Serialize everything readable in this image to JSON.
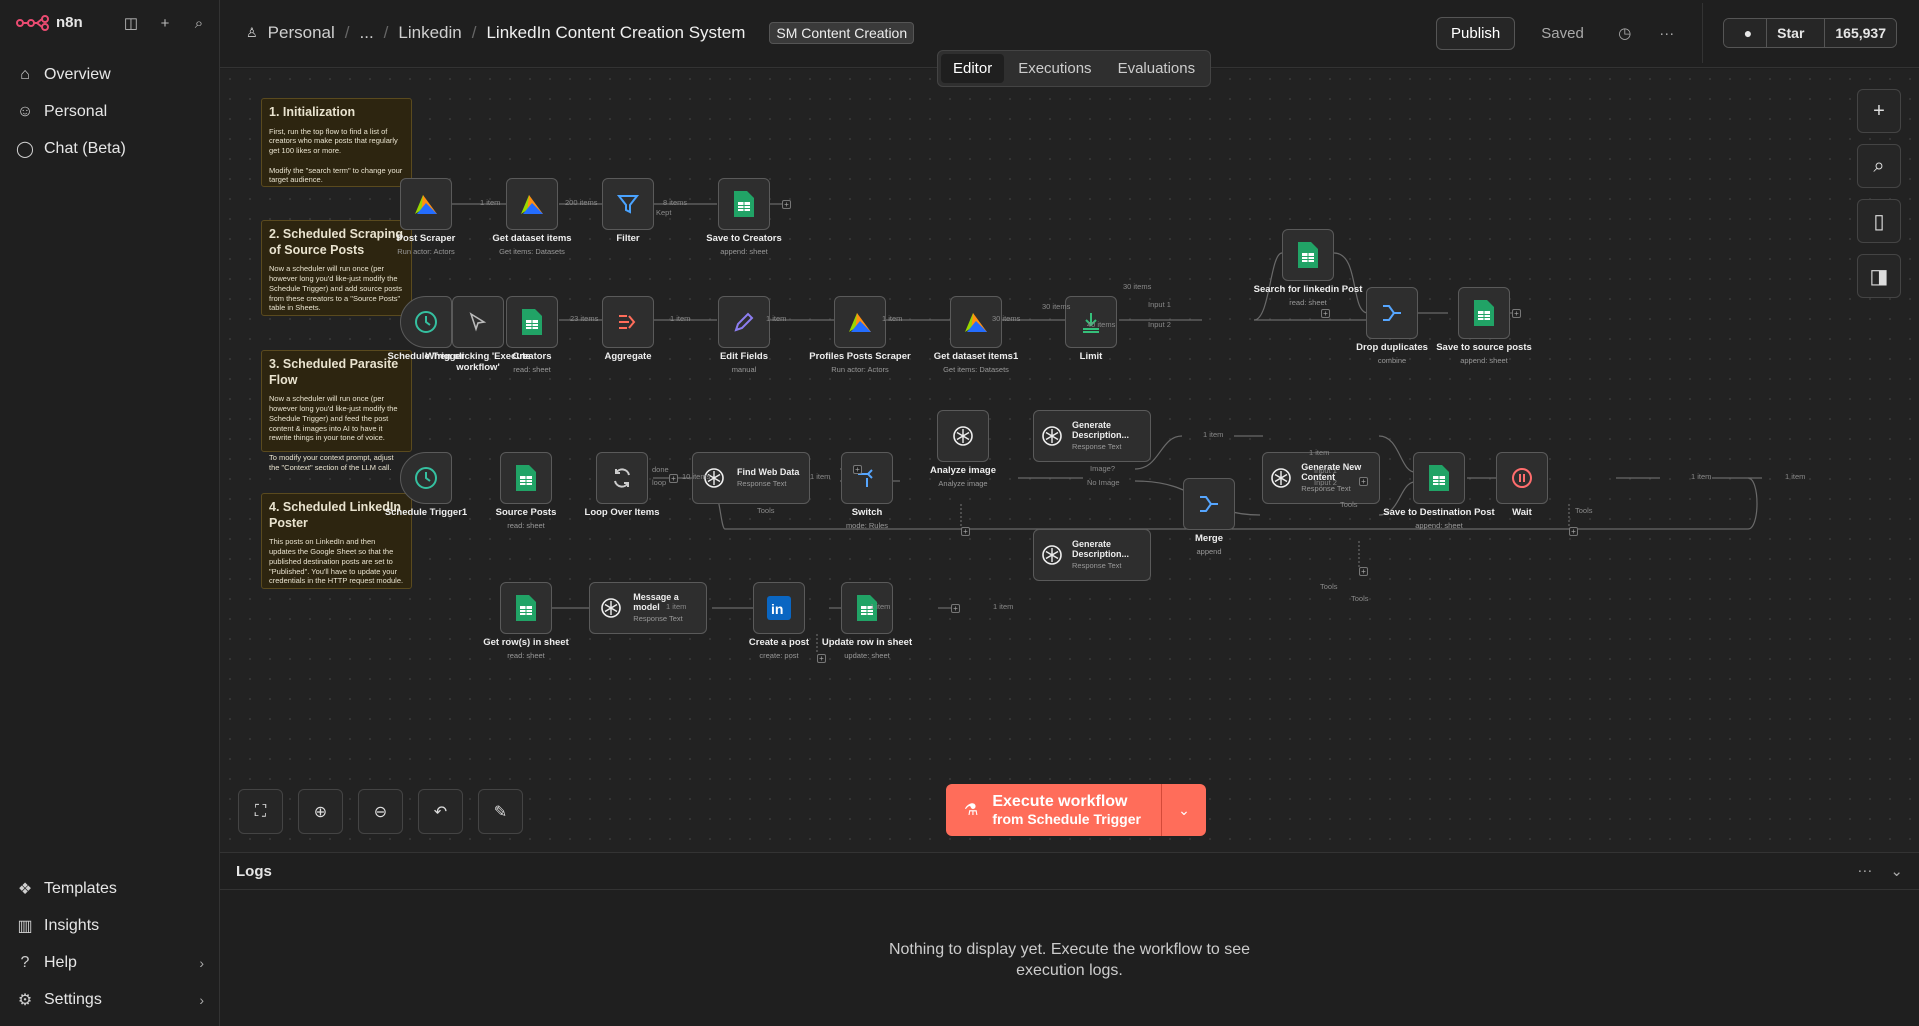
{
  "app": {
    "name": "n8n"
  },
  "sidebar": {
    "items": [
      {
        "label": "Overview",
        "icon": "home-icon"
      },
      {
        "label": "Personal",
        "icon": "user-icon"
      },
      {
        "label": "Chat (Beta)",
        "icon": "chat-icon"
      }
    ],
    "bottom": [
      {
        "label": "Templates",
        "icon": "templates-icon"
      },
      {
        "label": "Insights",
        "icon": "insights-icon"
      },
      {
        "label": "Help",
        "icon": "help-icon"
      },
      {
        "label": "Settings",
        "icon": "settings-icon"
      }
    ]
  },
  "header": {
    "breadcrumb": [
      "Personal",
      "...",
      "Linkedin"
    ],
    "title": "LinkedIn Content Creation System",
    "tag": "SM Content Creation",
    "publish": "Publish",
    "saved": "Saved",
    "github_star": "Star",
    "github_count": "165,937"
  },
  "tabs": [
    "Editor",
    "Executions",
    "Evaluations"
  ],
  "stickies": [
    {
      "title": "1. Initialization",
      "body": "First, run the top flow to find a list of creators who make posts that regularly get 100 likes or more.\n\nModify the \"search term\" to change your target audience."
    },
    {
      "title": "2. Scheduled Scraping of Source Posts",
      "body": "Now a scheduler will run once (per however long you'd like-just modify the Schedule Trigger) and add source posts from these creators to a \"Source Posts\" table in Sheets."
    },
    {
      "title": "3. Scheduled Parasite Flow",
      "body": "Now a scheduler will run once (per however long you'd like-just modify the Schedule Trigger) and feed the post content & images into AI to have it rewrite things in your tone of voice.\n\nTo modify your context prompt, adjust the \"Context\" section of the LLM call."
    },
    {
      "title": "4. Scheduled LinkedIn Poster",
      "body": "This posts on LinkedIn and then updates the Google Sheet so that the published destination posts are set to \"Published\". You'll have to update your credentials in the HTTP request module."
    }
  ],
  "nodes": [
    {
      "label": "Post Scraper",
      "sub": "Run actor: Actors",
      "icon": "apify-icon"
    },
    {
      "label": "Get dataset items",
      "sub": "Get items: Datasets",
      "icon": "apify-icon"
    },
    {
      "label": "Filter",
      "sub": "",
      "icon": "filter-icon"
    },
    {
      "label": "Save to Creators",
      "sub": "append: sheet",
      "icon": "sheets-icon"
    },
    {
      "label": "Schedule Trigger",
      "sub": "",
      "icon": "clock-icon"
    },
    {
      "label": "When clicking 'Execute workflow'",
      "sub": "",
      "icon": "cursor-icon"
    },
    {
      "label": "Creators",
      "sub": "read: sheet",
      "icon": "sheets-icon"
    },
    {
      "label": "Aggregate",
      "sub": "",
      "icon": "aggregate-icon"
    },
    {
      "label": "Edit Fields",
      "sub": "manual",
      "icon": "pencil-icon"
    },
    {
      "label": "Profiles Posts Scraper",
      "sub": "Run actor: Actors",
      "icon": "apify-icon"
    },
    {
      "label": "Get dataset items1",
      "sub": "Get items: Datasets",
      "icon": "apify-icon"
    },
    {
      "label": "Limit",
      "sub": "",
      "icon": "limit-icon"
    },
    {
      "label": "Search for linkedin Post",
      "sub": "read: sheet",
      "icon": "sheets-icon"
    },
    {
      "label": "Drop duplicates",
      "sub": "combine",
      "icon": "merge-icon"
    },
    {
      "label": "Save to source posts",
      "sub": "append: sheet",
      "icon": "sheets-icon"
    },
    {
      "label": "Schedule Trigger1",
      "sub": "",
      "icon": "clock-icon"
    },
    {
      "label": "Source Posts",
      "sub": "read: sheet",
      "icon": "sheets-icon"
    },
    {
      "label": "Loop Over Items",
      "sub": "",
      "icon": "loop-icon"
    },
    {
      "label": "Find Web Data",
      "sub": "Response Text",
      "icon": "openai-icon"
    },
    {
      "label": "Switch",
      "sub": "mode: Rules",
      "icon": "switch-icon"
    },
    {
      "label": "Analyze image",
      "sub": "Analyze image",
      "icon": "openai-icon"
    },
    {
      "label": "Generate Description...",
      "sub": "Response Text",
      "icon": "openai-icon"
    },
    {
      "label": "Generate Description...",
      "sub": "Response Text",
      "icon": "openai-icon"
    },
    {
      "label": "Merge",
      "sub": "append",
      "icon": "merge-icon"
    },
    {
      "label": "Generate New Content",
      "sub": "Response Text",
      "icon": "openai-icon"
    },
    {
      "label": "Save to Destination Post",
      "sub": "append: sheet",
      "icon": "sheets-icon"
    },
    {
      "label": "Wait",
      "sub": "",
      "icon": "pause-icon"
    },
    {
      "label": "Get row(s) in sheet",
      "sub": "read: sheet",
      "icon": "sheets-icon"
    },
    {
      "label": "Message a model",
      "sub": "Response Text",
      "icon": "openai-icon"
    },
    {
      "label": "Create a post",
      "sub": "create: post",
      "icon": "linkedin-icon"
    },
    {
      "label": "Update row in sheet",
      "sub": "update: sheet",
      "icon": "sheets-icon"
    }
  ],
  "edge_labels": [
    "1 item",
    "200 items",
    "8 items",
    "Kept",
    "23 items",
    "1 item",
    "1 item",
    "1 item",
    "30 items",
    "30 items",
    "40 items",
    "30 items",
    "Input 1",
    "Input 2",
    "10 items",
    "done",
    "loop",
    "1 item",
    "Image?",
    "No Image",
    "1 item",
    "1 item",
    "Input 1",
    "Input 2",
    "1 item",
    "1 item",
    "1 item",
    "1 item",
    "1 item",
    "Tools",
    "Tools",
    "Tools",
    "Tools",
    "Tools"
  ],
  "execute": {
    "line1": "Execute workflow",
    "line2": "from Schedule Trigger"
  },
  "logs": {
    "title": "Logs",
    "empty": "Nothing to display yet. Execute the workflow to see execution logs."
  },
  "colors": {
    "accent": "#ff6d5a",
    "sticky_bg": "#2d2510",
    "sheets": "#21a366",
    "openai": "#ffffff",
    "linkedin": "#0a66c2"
  }
}
